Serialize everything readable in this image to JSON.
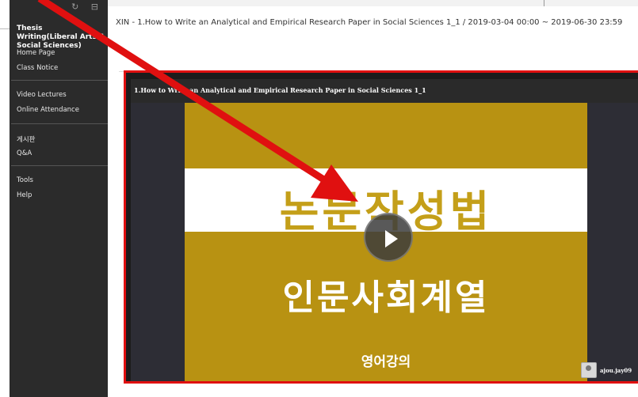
{
  "sidebar": {
    "top_icons": "↻ ⊟",
    "course_title": "Thesis Writing(Liberal Arts & Social Sciences)",
    "items": [
      {
        "label": "Home Page"
      },
      {
        "label": "Class Notice"
      },
      {
        "label": "Video Lectures"
      },
      {
        "label": "Online Attendance"
      },
      {
        "label": "게시판"
      },
      {
        "label": "Q&A"
      },
      {
        "label": "Tools"
      },
      {
        "label": "Help"
      }
    ]
  },
  "page": {
    "title": "XIN - 1.How to Write an Analytical and Empirical Research Paper in Social Sciences 1_1 / 2019-03-04 00:00 ~ 2019-06-30 23:59"
  },
  "video": {
    "title": "1.How to Write an Analytical and Empirical Research Paper in Social Sciences 1_1",
    "slide_main": "논문작성법",
    "slide_sub": "인문사회계열",
    "slide_small": "영어강의",
    "watermark_user": "ajou.jay09"
  },
  "colors": {
    "sidebar_bg": "#2b2b2b",
    "slide_gold": "#b89212",
    "highlight_red": "#e01010"
  }
}
